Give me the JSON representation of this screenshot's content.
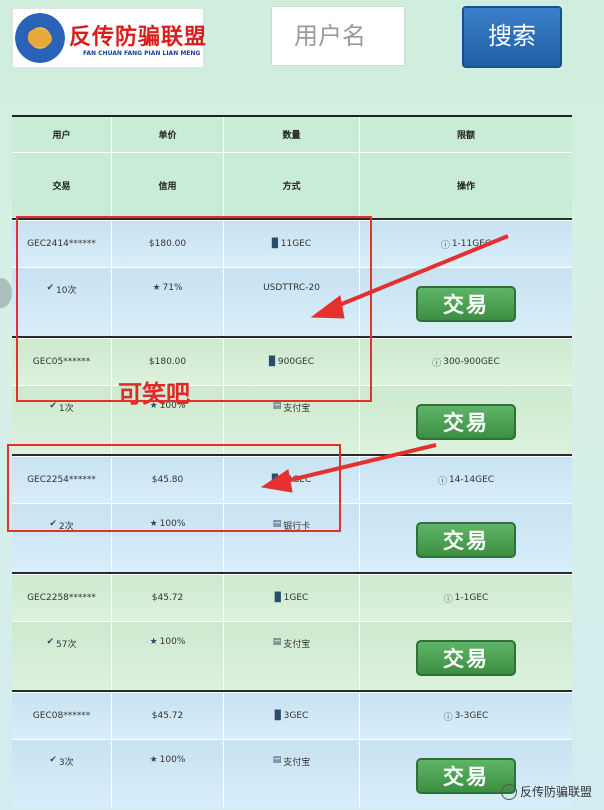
{
  "header": {
    "logo_title": "反传防骗联盟",
    "logo_subtitle": "FAN CHUAN FANG PIAN LIAN MENG",
    "search_placeholder": "用户名",
    "search_button": "搜索"
  },
  "table": {
    "header_row1": [
      "用户",
      "单价",
      "数量",
      "限额"
    ],
    "header_row2": [
      "交易",
      "信用",
      "方式",
      "操作"
    ],
    "trade_label": "交易",
    "rows": [
      {
        "user": "GEC2414******",
        "price": "$180.00",
        "quantity": "11GEC",
        "limit": "1-11GEC",
        "trades": "10次",
        "credit": "71%",
        "method": "USDTTRC-20",
        "method_icon": "none",
        "bg": "blue"
      },
      {
        "user": "GEC05******",
        "price": "$180.00",
        "quantity": "900GEC",
        "limit": "300-900GEC",
        "trades": "1次",
        "credit": "100%",
        "method": "支付宝",
        "method_icon": "card-icon",
        "bg": "green"
      },
      {
        "user": "GEC2254******",
        "price": "$45.80",
        "quantity": "14GEC",
        "limit": "14-14GEC",
        "trades": "2次",
        "credit": "100%",
        "method": "银行卡",
        "method_icon": "card-icon",
        "bg": "blue"
      },
      {
        "user": "GEC2258******",
        "price": "$45.72",
        "quantity": "1GEC",
        "limit": "1-1GEC",
        "trades": "57次",
        "credit": "100%",
        "method": "支付宝",
        "method_icon": "card-icon",
        "bg": "green"
      },
      {
        "user": "GEC08******",
        "price": "$45.72",
        "quantity": "3GEC",
        "limit": "3-3GEC",
        "trades": "3次",
        "credit": "100%",
        "method": "支付宝",
        "method_icon": "card-icon",
        "bg": "blue"
      }
    ]
  },
  "annotation": {
    "text": "可笑吧",
    "color": "#e53030"
  },
  "watermark": "反传防骗联盟"
}
